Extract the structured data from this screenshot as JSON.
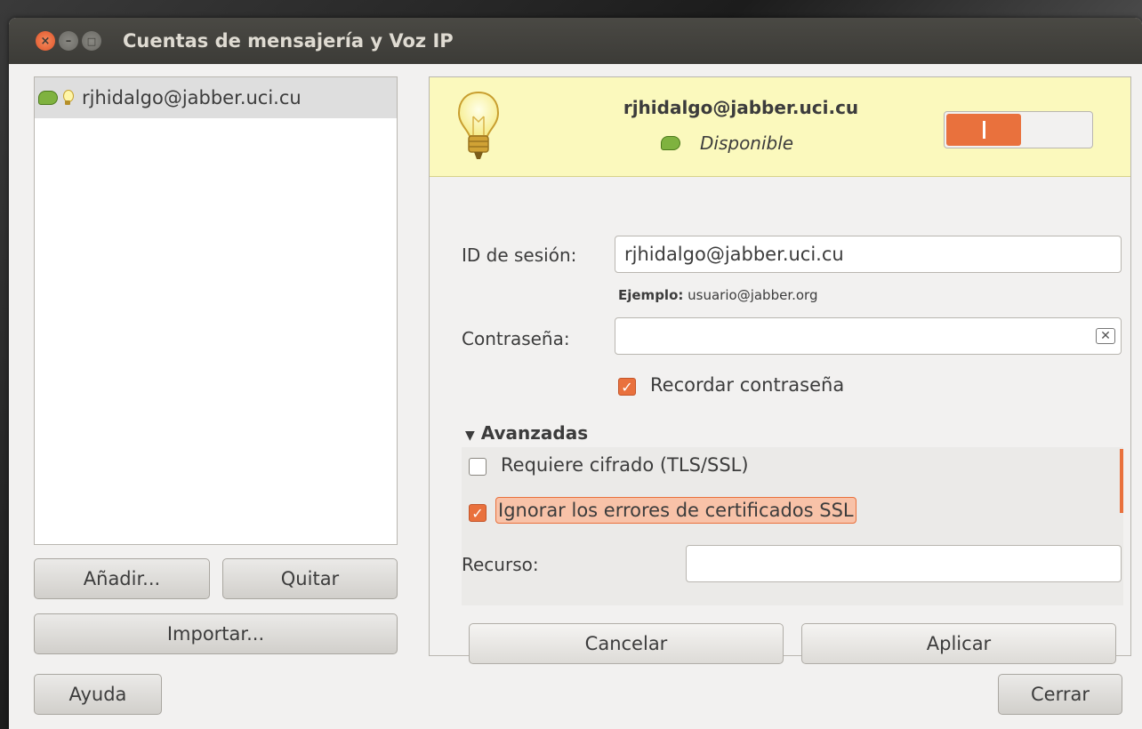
{
  "window": {
    "title": "Cuentas de mensajería y Voz IP",
    "controls": {
      "close": "×",
      "minimize": "–",
      "maximize": "□"
    }
  },
  "accounts": {
    "items": [
      {
        "label": "rjhidalgo@jabber.uci.cu",
        "selected": true
      }
    ],
    "add_label": "Añadir...",
    "remove_label": "Quitar",
    "import_label": "Importar..."
  },
  "account_info": {
    "name": "rjhidalgo@jabber.uci.cu",
    "status": "Disponible",
    "enabled": true
  },
  "form": {
    "login_id_label": "ID de sesión:",
    "login_id_value": "rjhidalgo@jabber.uci.cu",
    "example_prefix": "Ejemplo:",
    "example_value": "usuario@jabber.org",
    "password_label": "Contraseña:",
    "password_value": "",
    "remember_password_label": "Recordar contraseña",
    "remember_password_checked": true,
    "advanced_label": "Avanzadas",
    "encryption_label": "Requiere cifrado (TLS/SSL)",
    "encryption_checked": false,
    "ignore_ssl_label": "Ignorar los errores de certificados SSL",
    "ignore_ssl_checked": true,
    "resource_label": "Recurso:",
    "resource_value": ""
  },
  "actions": {
    "cancel_label": "Cancelar",
    "apply_label": "Aplicar"
  },
  "footer": {
    "help_label": "Ayuda",
    "close_label": "Cerrar"
  },
  "colors": {
    "accent": "#e9713d",
    "info_bar": "#fbf9bd",
    "status_green": "#7fb23f"
  }
}
